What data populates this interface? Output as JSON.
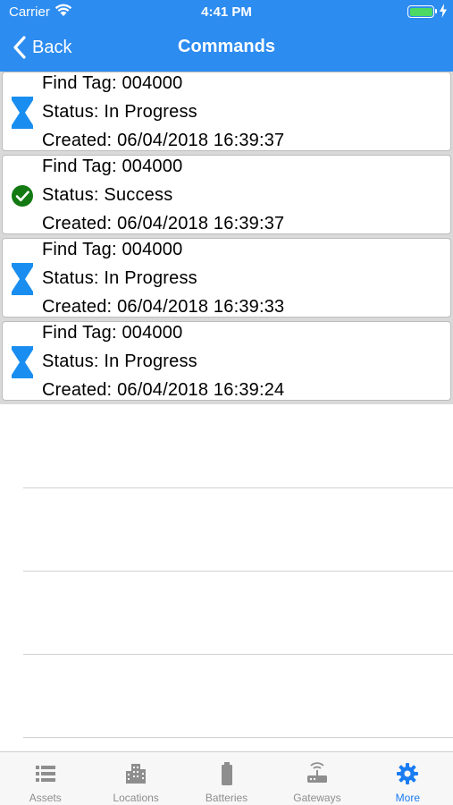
{
  "status_bar": {
    "carrier": "Carrier",
    "time": "4:41 PM"
  },
  "nav": {
    "back_label": "Back",
    "title": "Commands"
  },
  "commands": [
    {
      "title": "Find Tag: 004000",
      "status": "Status: In Progress",
      "created": "Created: 06/04/2018 16:39:37",
      "icon": "hourglass-icon"
    },
    {
      "title": "Find Tag: 004000",
      "status": "Status: Success",
      "created": "Created: 06/04/2018 16:39:37",
      "icon": "check-circle-icon"
    },
    {
      "title": "Find Tag: 004000",
      "status": "Status: In Progress",
      "created": "Created: 06/04/2018 16:39:33",
      "icon": "hourglass-icon"
    },
    {
      "title": "Find Tag: 004000",
      "status": "Status: In Progress",
      "created": "Created: 06/04/2018 16:39:24",
      "icon": "hourglass-icon"
    }
  ],
  "tabs": [
    {
      "label": "Assets",
      "icon": "list-icon",
      "active": false
    },
    {
      "label": "Locations",
      "icon": "buildings-icon",
      "active": false
    },
    {
      "label": "Batteries",
      "icon": "battery-icon",
      "active": false
    },
    {
      "label": "Gateways",
      "icon": "router-icon",
      "active": false
    },
    {
      "label": "More",
      "icon": "gear-icon",
      "active": true
    }
  ],
  "colors": {
    "nav_bg": "#2d8cf0",
    "hourglass": "#1a8ef0",
    "success": "#137a13",
    "tab_active": "#1a7cf2",
    "tab_inactive": "#8e8e8e"
  }
}
